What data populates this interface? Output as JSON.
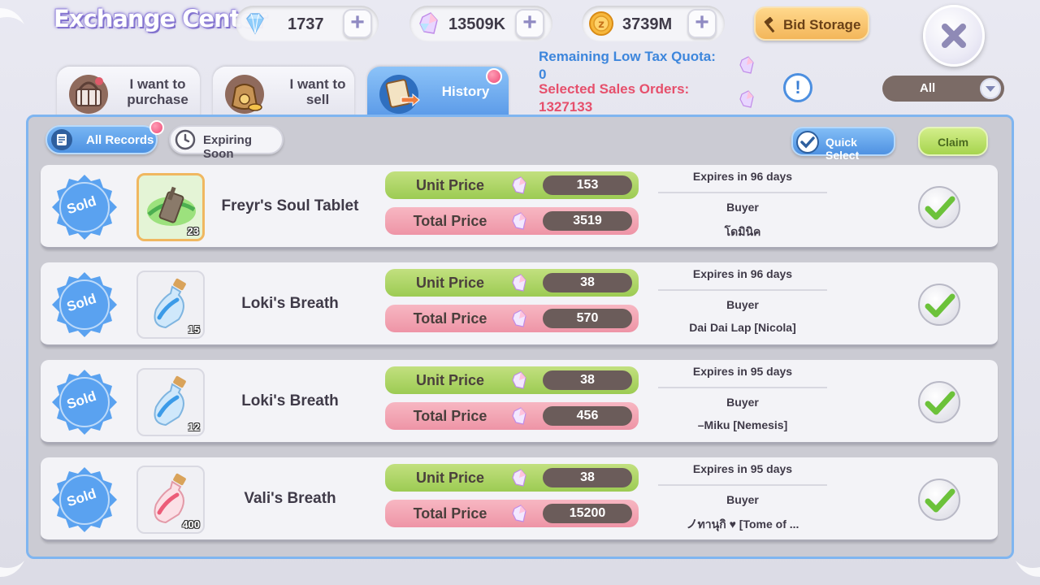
{
  "header": {
    "title": "Exchange Center",
    "currencies": [
      {
        "icon": "diamond-icon",
        "value": "1737"
      },
      {
        "icon": "crystal-icon",
        "value": "13509K"
      },
      {
        "icon": "zeny-coin-icon",
        "value": "3739M"
      }
    ],
    "bid_storage_label": "Bid Storage"
  },
  "tabs": [
    {
      "label": "I want to purchase",
      "icon": "shopping-basket-icon",
      "active": false
    },
    {
      "label": "I want to sell",
      "icon": "money-bag-icon",
      "active": false
    },
    {
      "label": "History",
      "icon": "scroll-history-icon",
      "active": true
    }
  ],
  "quota": {
    "remaining_label": "Remaining Low Tax Quota:",
    "remaining_value": "0",
    "selected_label": "Selected Sales Orders:",
    "selected_value": "1327133"
  },
  "filter": {
    "selected": "All"
  },
  "subtabs": {
    "all_records": "All Records",
    "expiring_soon": "Expiring Soon"
  },
  "actions": {
    "quick_select": "Quick Select",
    "claim": "Claim"
  },
  "records": [
    {
      "status": "Sold",
      "item_name": "Freyr's Soul Tablet",
      "quantity": "23",
      "unit_price_label": "Unit Price",
      "unit_price": "153",
      "total_price_label": "Total Price",
      "total_price": "3519",
      "expires": "Expires in 96 days",
      "buyer_label": "Buyer",
      "buyer": "โดมินิค",
      "item_icon": "soul-tablet-icon"
    },
    {
      "status": "Sold",
      "item_name": "Loki's Breath",
      "quantity": "15",
      "unit_price_label": "Unit Price",
      "unit_price": "38",
      "total_price_label": "Total Price",
      "total_price": "570",
      "expires": "Expires in 96 days",
      "buyer_label": "Buyer",
      "buyer": "Dai Dai Lap [Nicola]",
      "item_icon": "blue-bottle-icon"
    },
    {
      "status": "Sold",
      "item_name": "Loki's Breath",
      "quantity": "12",
      "unit_price_label": "Unit Price",
      "unit_price": "38",
      "total_price_label": "Total Price",
      "total_price": "456",
      "expires": "Expires in 95 days",
      "buyer_label": "Buyer",
      "buyer": "–Miku [Nemesis]",
      "item_icon": "blue-bottle-icon"
    },
    {
      "status": "Sold",
      "item_name": "Vali's Breath",
      "quantity": "400",
      "unit_price_label": "Unit Price",
      "unit_price": "38",
      "total_price_label": "Total Price",
      "total_price": "15200",
      "expires": "Expires in 95 days",
      "buyer_label": "Buyer",
      "buyer": "ノทานุกิ ♥ [Tome of ...",
      "item_icon": "red-bottle-icon"
    }
  ]
}
